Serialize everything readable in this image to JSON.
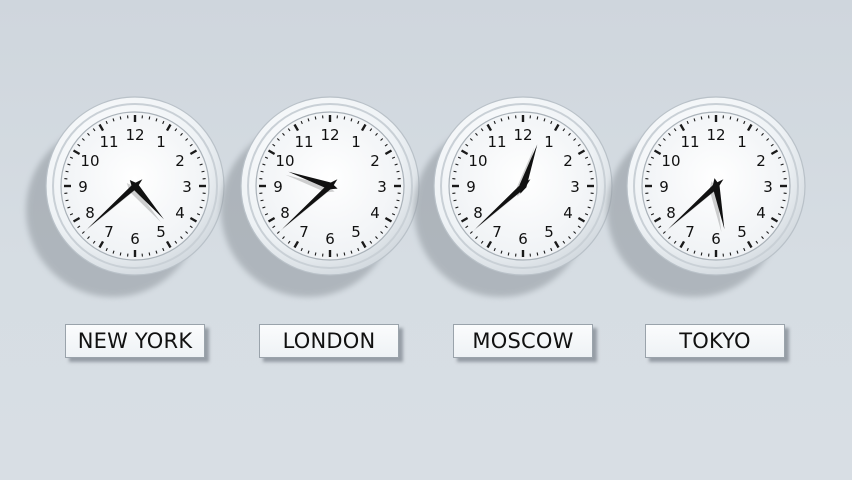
{
  "clocks": [
    {
      "city": "NEW YORK",
      "hour": 4,
      "minute": 38,
      "numerals": [
        "12",
        "1",
        "2",
        "3",
        "4",
        "5",
        "6",
        "7",
        "8",
        "9",
        "10",
        "11"
      ]
    },
    {
      "city": "LONDON",
      "hour": 9,
      "minute": 38,
      "numerals": [
        "12",
        "1",
        "2",
        "3",
        "4",
        "5",
        "6",
        "7",
        "8",
        "9",
        "10",
        "11"
      ]
    },
    {
      "city": "MOSCOW",
      "hour": 12,
      "minute": 38,
      "numerals": [
        "12",
        "1",
        "2",
        "3",
        "4",
        "5",
        "6",
        "7",
        "8",
        "9",
        "10",
        "11"
      ]
    },
    {
      "city": "TOKYO",
      "hour": 5,
      "minute": 38,
      "numerals": [
        "12",
        "1",
        "2",
        "3",
        "4",
        "5",
        "6",
        "7",
        "8",
        "9",
        "10",
        "11"
      ]
    }
  ],
  "colors": {
    "wall": "#d4dbe1",
    "rim": "#f7f9fb",
    "face": "#f9fafb",
    "hands": "#111111",
    "shadow": "#8f969d"
  }
}
